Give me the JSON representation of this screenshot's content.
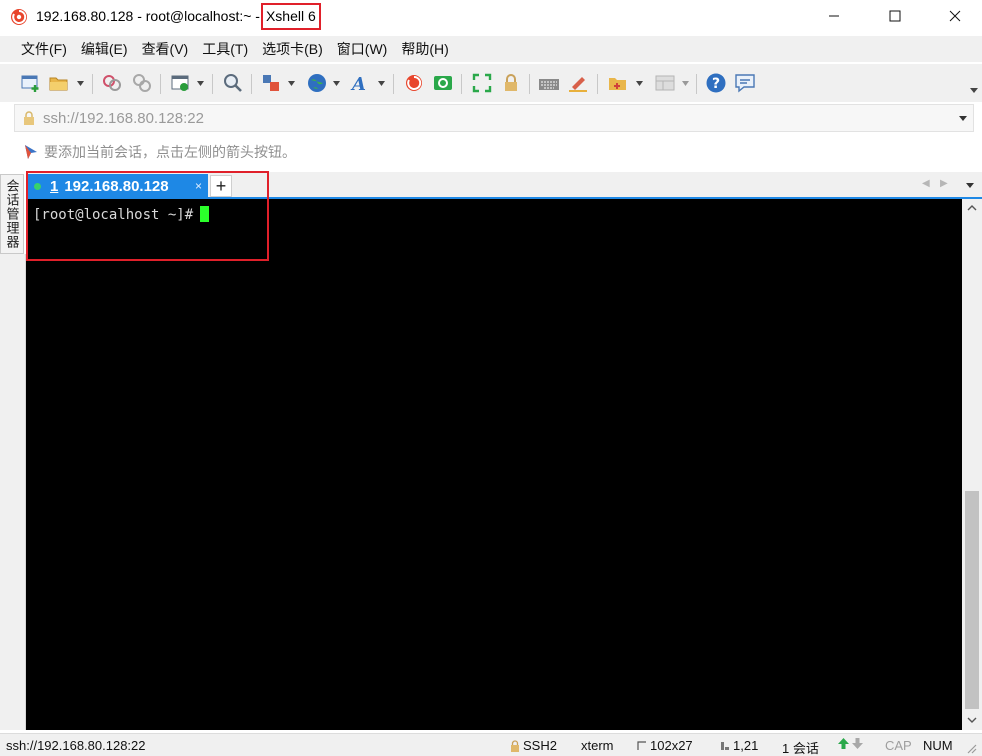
{
  "window": {
    "title": "192.168.80.128 - root@localhost:~ -",
    "app_name": "Xshell 6"
  },
  "menu": [
    {
      "label": "文件(F)",
      "name": "menu-file"
    },
    {
      "label": "编辑(E)",
      "name": "menu-edit"
    },
    {
      "label": "查看(V)",
      "name": "menu-view"
    },
    {
      "label": "工具(T)",
      "name": "menu-tools"
    },
    {
      "label": "选项卡(B)",
      "name": "menu-tabs"
    },
    {
      "label": "窗口(W)",
      "name": "menu-window"
    },
    {
      "label": "帮助(H)",
      "name": "menu-help"
    }
  ],
  "toolbar_icons": [
    "new-session-icon",
    "open-folder-icon",
    "disconnect-icon",
    "reconnect-icon",
    "properties-icon",
    "find-icon",
    "transfer-icon",
    "globe-icon",
    "font-icon",
    "xshell-icon",
    "xftp-icon",
    "fullscreen-icon",
    "lock-icon",
    "keyboard-icon",
    "highlight-pen-icon",
    "compose-icon",
    "layout-icon",
    "help-icon",
    "chat-icon"
  ],
  "address": {
    "value": "ssh://192.168.80.128:22"
  },
  "hint": {
    "text": "要添加当前会话，点击左侧的箭头按钮。"
  },
  "side_panel": {
    "label": "会话管理器"
  },
  "tab": {
    "number": "1",
    "label": "192.168.80.128",
    "close": "×",
    "add": "+"
  },
  "terminal": {
    "prompt": "[root@localhost ~]#",
    "background": "#000000",
    "cursor_color": "#2bff2b"
  },
  "status": {
    "connection": "ssh://192.168.80.128:22",
    "protocol": "SSH2",
    "terminal_type": "xterm",
    "size": "102x27",
    "cursor_pos": "1,21",
    "sessions": "1 会话",
    "caps": "CAP",
    "num": "NUM"
  },
  "colors": {
    "accent": "#1e88e5",
    "highlight_box": "#e0202a"
  }
}
